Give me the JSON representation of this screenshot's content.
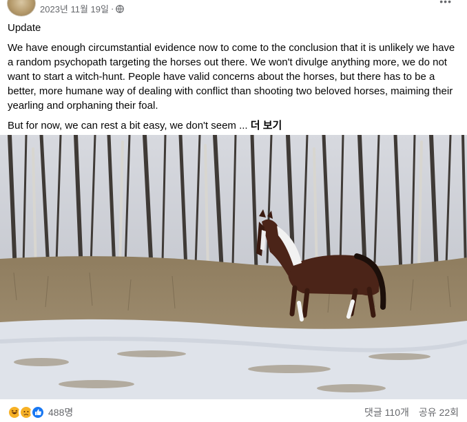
{
  "post": {
    "date": "2023년 11월 19일",
    "date_separator": "·",
    "more_icon": "more-dots-icon",
    "privacy_icon": "globe-icon",
    "title": "Update",
    "body": "We have enough circumstantial evidence now to come to the conclusion that it is unlikely we have a random psychopath targeting the horses out there. We won't divulge anything more, we do not want to start a witch-hunt. People have valid concerns about the horses, but there has to be a better, more humane way of dealing with conflict than shooting two beloved horses, maiming their yearling and orphaning their foal.",
    "teaser": "But for now, we can rest a bit easy, we don't seem ...",
    "see_more": "더 보기"
  },
  "photo": {
    "icon": "horse-photo",
    "colors": {
      "sky": "#c9ccd4",
      "grass": "#9c8a68",
      "snow": "#dfe3ea",
      "horse": "#4b2418"
    }
  },
  "footer": {
    "reactions": [
      "haha-icon",
      "sad-icon",
      "like-icon"
    ],
    "reaction_count": "488명",
    "comments": "댓글 110개",
    "shares": "공유 22회"
  },
  "colors": {
    "secondary_text": "#65676b",
    "like_blue": "#1877f2",
    "reaction_yellow": "#f7b125"
  }
}
